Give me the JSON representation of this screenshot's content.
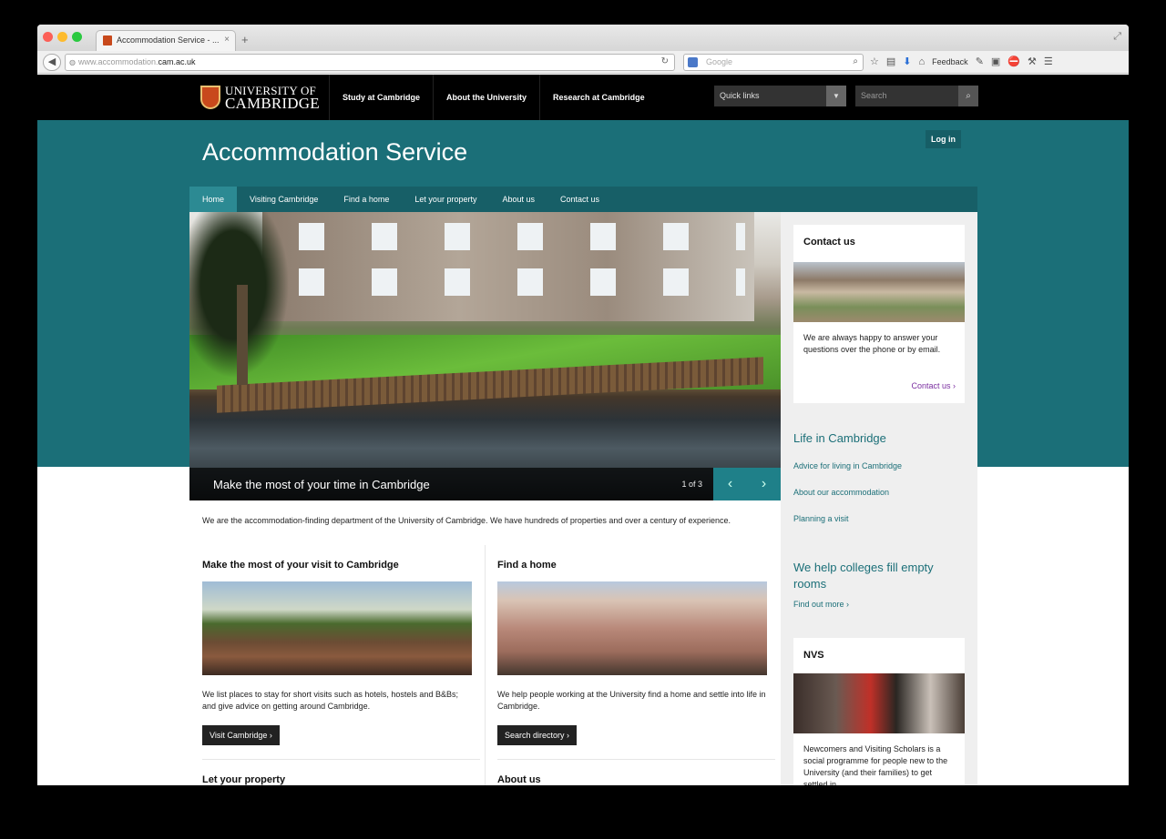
{
  "browser": {
    "tab_title": "Accommodation Service - ...",
    "tab_close": "×",
    "new_tab": "+",
    "url_prefix": "www.accommodation.",
    "url_domain": "cam.ac.uk",
    "search_placeholder": "Google",
    "feedback_label": "Feedback"
  },
  "header": {
    "logo_line1": "UNIVERSITY OF",
    "logo_line2": "CAMBRIDGE",
    "nav": [
      "Study at Cambridge",
      "About the University",
      "Research at Cambridge"
    ],
    "quick_links": "Quick links",
    "search_placeholder": "Search"
  },
  "site": {
    "title": "Accommodation Service",
    "login": "Log in",
    "subnav": [
      "Home",
      "Visiting Cambridge",
      "Find a home",
      "Let your property",
      "About us",
      "Contact us"
    ]
  },
  "slideshow": {
    "caption": "Make the most of your time in Cambridge",
    "counter": "1 of 3",
    "prev": "‹",
    "next": "›"
  },
  "intro": "We are the accommodation-finding department of the University of Cambridge. We have hundreds of properties and over a century of experience.",
  "columns": [
    {
      "title": "Make the most of your visit to Cambridge",
      "text": "We list places to stay for short visits such as hotels, hostels and B&Bs; and give advice on getting around Cambridge.",
      "button": "Visit Cambridge ›",
      "next_title": "Let your property"
    },
    {
      "title": "Find a home",
      "text": "We help people working at the University find a home and settle into life in Cambridge.",
      "button": "Search directory ›",
      "next_title": "About us"
    }
  ],
  "sidebar": {
    "contact": {
      "title": "Contact us",
      "text": "We are always happy to answer your questions over the phone or by email.",
      "link": "Contact us ›"
    },
    "life": {
      "title": "Life in Cambridge",
      "links": [
        "Advice for living in Cambridge",
        "About our accommodation",
        "Planning a visit"
      ]
    },
    "colleges": {
      "title": "We help colleges fill empty rooms",
      "link": "Find out more ›"
    },
    "nvs": {
      "title": "NVS",
      "text": "Newcomers and Visiting Scholars is a social programme for people new to the University (and their families) to get settled in."
    }
  },
  "colors": {
    "teal": "#1b6f78",
    "dark_teal": "#175f67",
    "active_tab": "#2c8a93",
    "link_purple": "#7a2ea0"
  }
}
